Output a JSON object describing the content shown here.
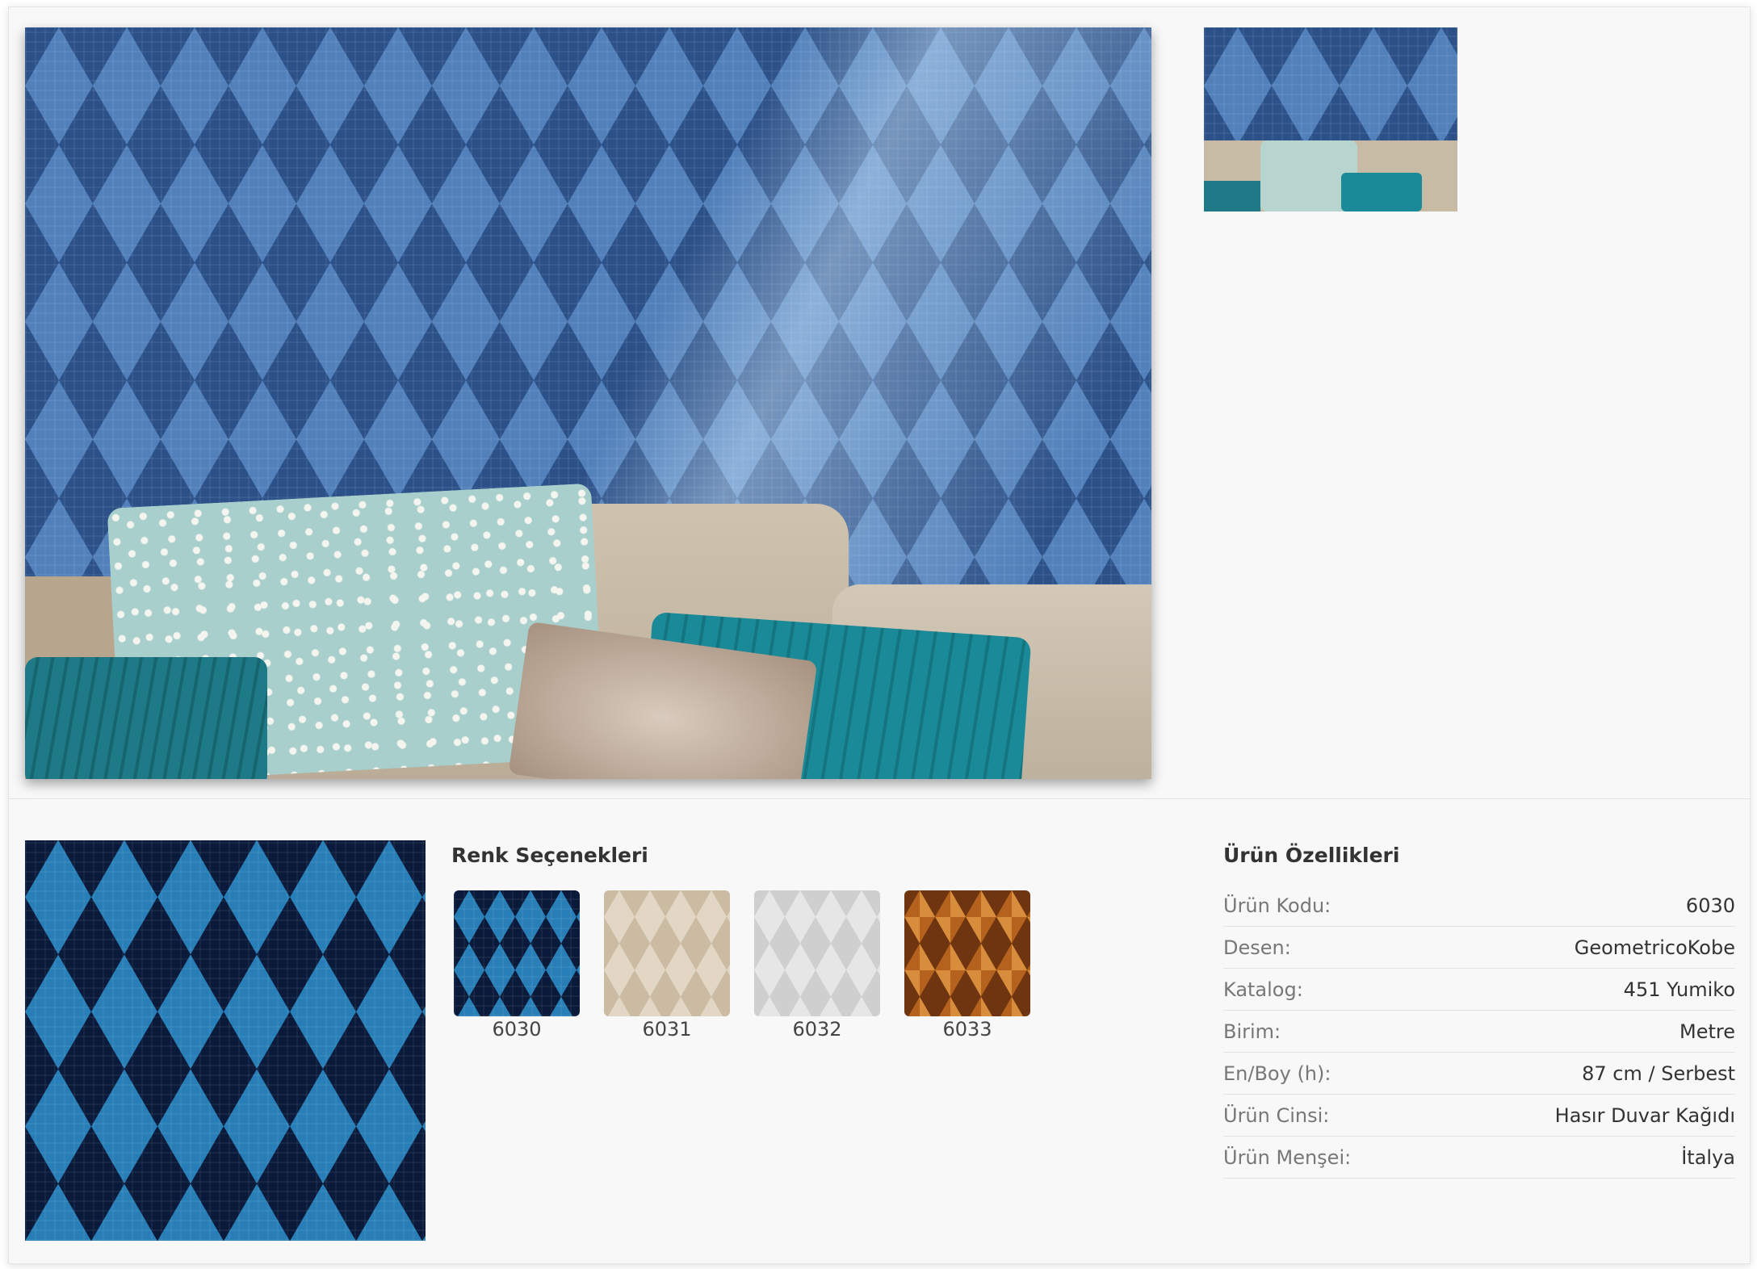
{
  "gallery": {
    "main_image_alt": "Blue geometric wallpaper with sofa and pillows",
    "thumbnail_alt": "Thumbnail of room with blue geometric wallpaper"
  },
  "color_options": {
    "title": "Renk Seçenekleri",
    "items": [
      {
        "code": "6030",
        "color": "#1e4f8f"
      },
      {
        "code": "6031",
        "color": "#e2d6c4"
      },
      {
        "code": "6032",
        "color": "#e6e6e6"
      },
      {
        "code": "6033",
        "color": "#b4621d"
      }
    ]
  },
  "specs": {
    "title": "Ürün Özellikleri",
    "rows": [
      {
        "label": "Ürün Kodu:",
        "value": "6030"
      },
      {
        "label": "Desen:",
        "value": "GeometricoKobe"
      },
      {
        "label": "Katalog:",
        "value": "451 Yumiko"
      },
      {
        "label": "Birim:",
        "value": "Metre"
      },
      {
        "label": "En/Boy (h):",
        "value": "87 cm / Serbest"
      },
      {
        "label": "Ürün Cinsi:",
        "value": "Hasır Duvar Kağıdı"
      },
      {
        "label": "Ürün Menşei:",
        "value": "İtalya"
      }
    ]
  }
}
